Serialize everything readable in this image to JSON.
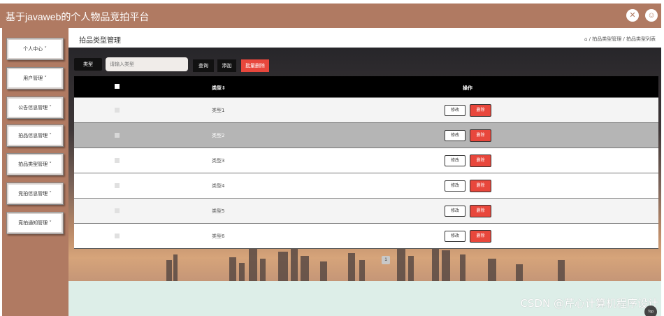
{
  "app": {
    "title": "基于javaweb的个人物品竞拍平台",
    "icons": [
      "close-icon",
      "user-icon"
    ]
  },
  "sidebar": {
    "items": [
      {
        "label": "个人中心 ˅"
      },
      {
        "label": "用户管理 ˅"
      },
      {
        "label": "公告信息管理 ˅"
      },
      {
        "label": "拍品信息管理 ˅"
      },
      {
        "label": "拍品类型管理 ˅"
      },
      {
        "label": "竞拍信息管理 ˅"
      },
      {
        "label": "竞拍通知管理 ˅"
      }
    ]
  },
  "page": {
    "title": "拍品类型管理",
    "breadcrumb": "⌂ / 拍品类型管理 / 拍品类型列表"
  },
  "filter": {
    "label": "类型",
    "placeholder": "请输入类型",
    "search_label": "查询",
    "add_label": "添加",
    "batch_delete_label": "批量删除"
  },
  "table": {
    "headers": {
      "type": "类型⇕",
      "actions": "操作"
    },
    "rows": [
      {
        "type": "类型1"
      },
      {
        "type": "类型2"
      },
      {
        "type": "类型3"
      },
      {
        "type": "类型4"
      },
      {
        "type": "类型5"
      },
      {
        "type": "类型6"
      }
    ],
    "edit_label": "修改",
    "delete_label": "删除"
  },
  "pagination": {
    "current": "1"
  },
  "watermark": "CSDN @芹心计算机程序设计",
  "back_to_top": "Top",
  "colors": {
    "brand": "#b07a62",
    "danger": "#e8473c",
    "header": "#000000"
  }
}
